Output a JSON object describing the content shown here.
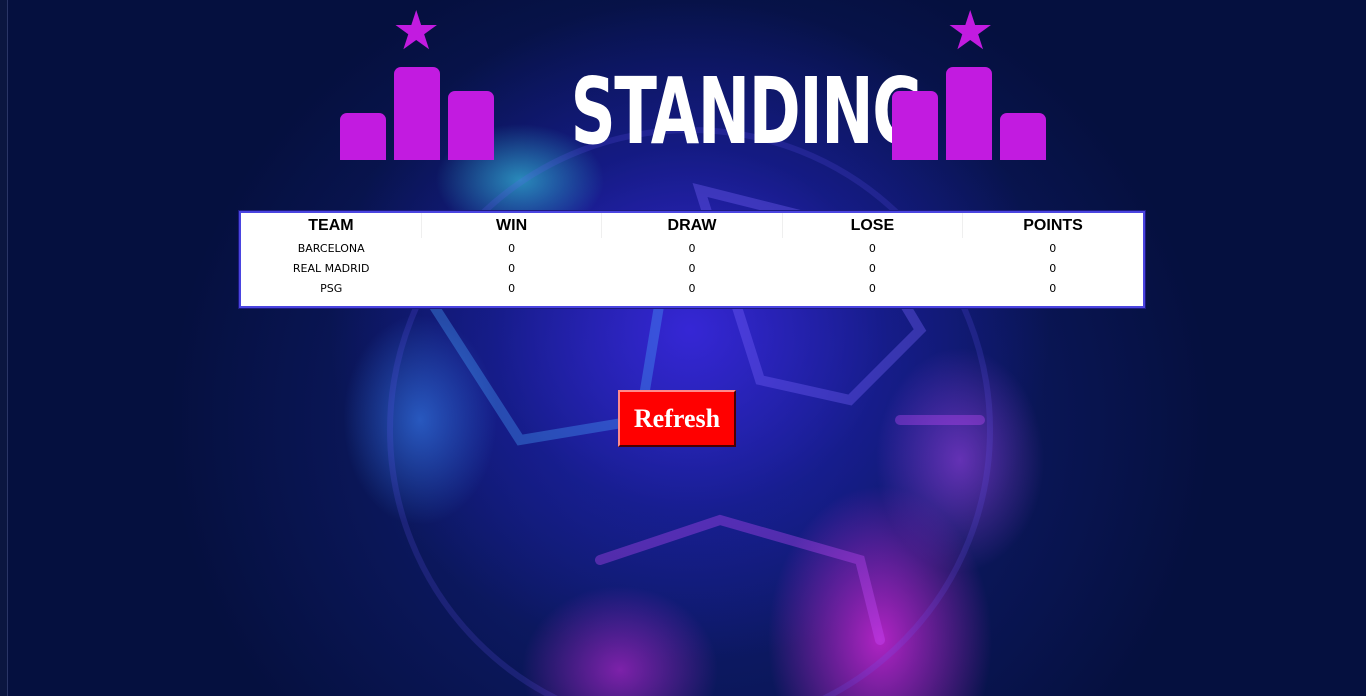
{
  "header": {
    "title": "STANDING",
    "accent_color": "#c21be0",
    "star_icon": "★"
  },
  "standings": {
    "columns": [
      "TEAM",
      "WIN",
      "DRAW",
      "LOSE",
      "POINTS"
    ],
    "rows": [
      {
        "team": "BARCELONA",
        "win": "0",
        "draw": "0",
        "lose": "0",
        "points": "0"
      },
      {
        "team": "REAL MADRID",
        "win": "0",
        "draw": "0",
        "lose": "0",
        "points": "0"
      },
      {
        "team": "PSG",
        "win": "0",
        "draw": "0",
        "lose": "0",
        "points": "0"
      }
    ]
  },
  "actions": {
    "refresh_label": "Refresh",
    "refresh_color": "#ff0000"
  },
  "background": {
    "base_color": "#05103f",
    "glow_colors": [
      "#3c28e6",
      "#e628e6",
      "#3ce6f0"
    ]
  }
}
